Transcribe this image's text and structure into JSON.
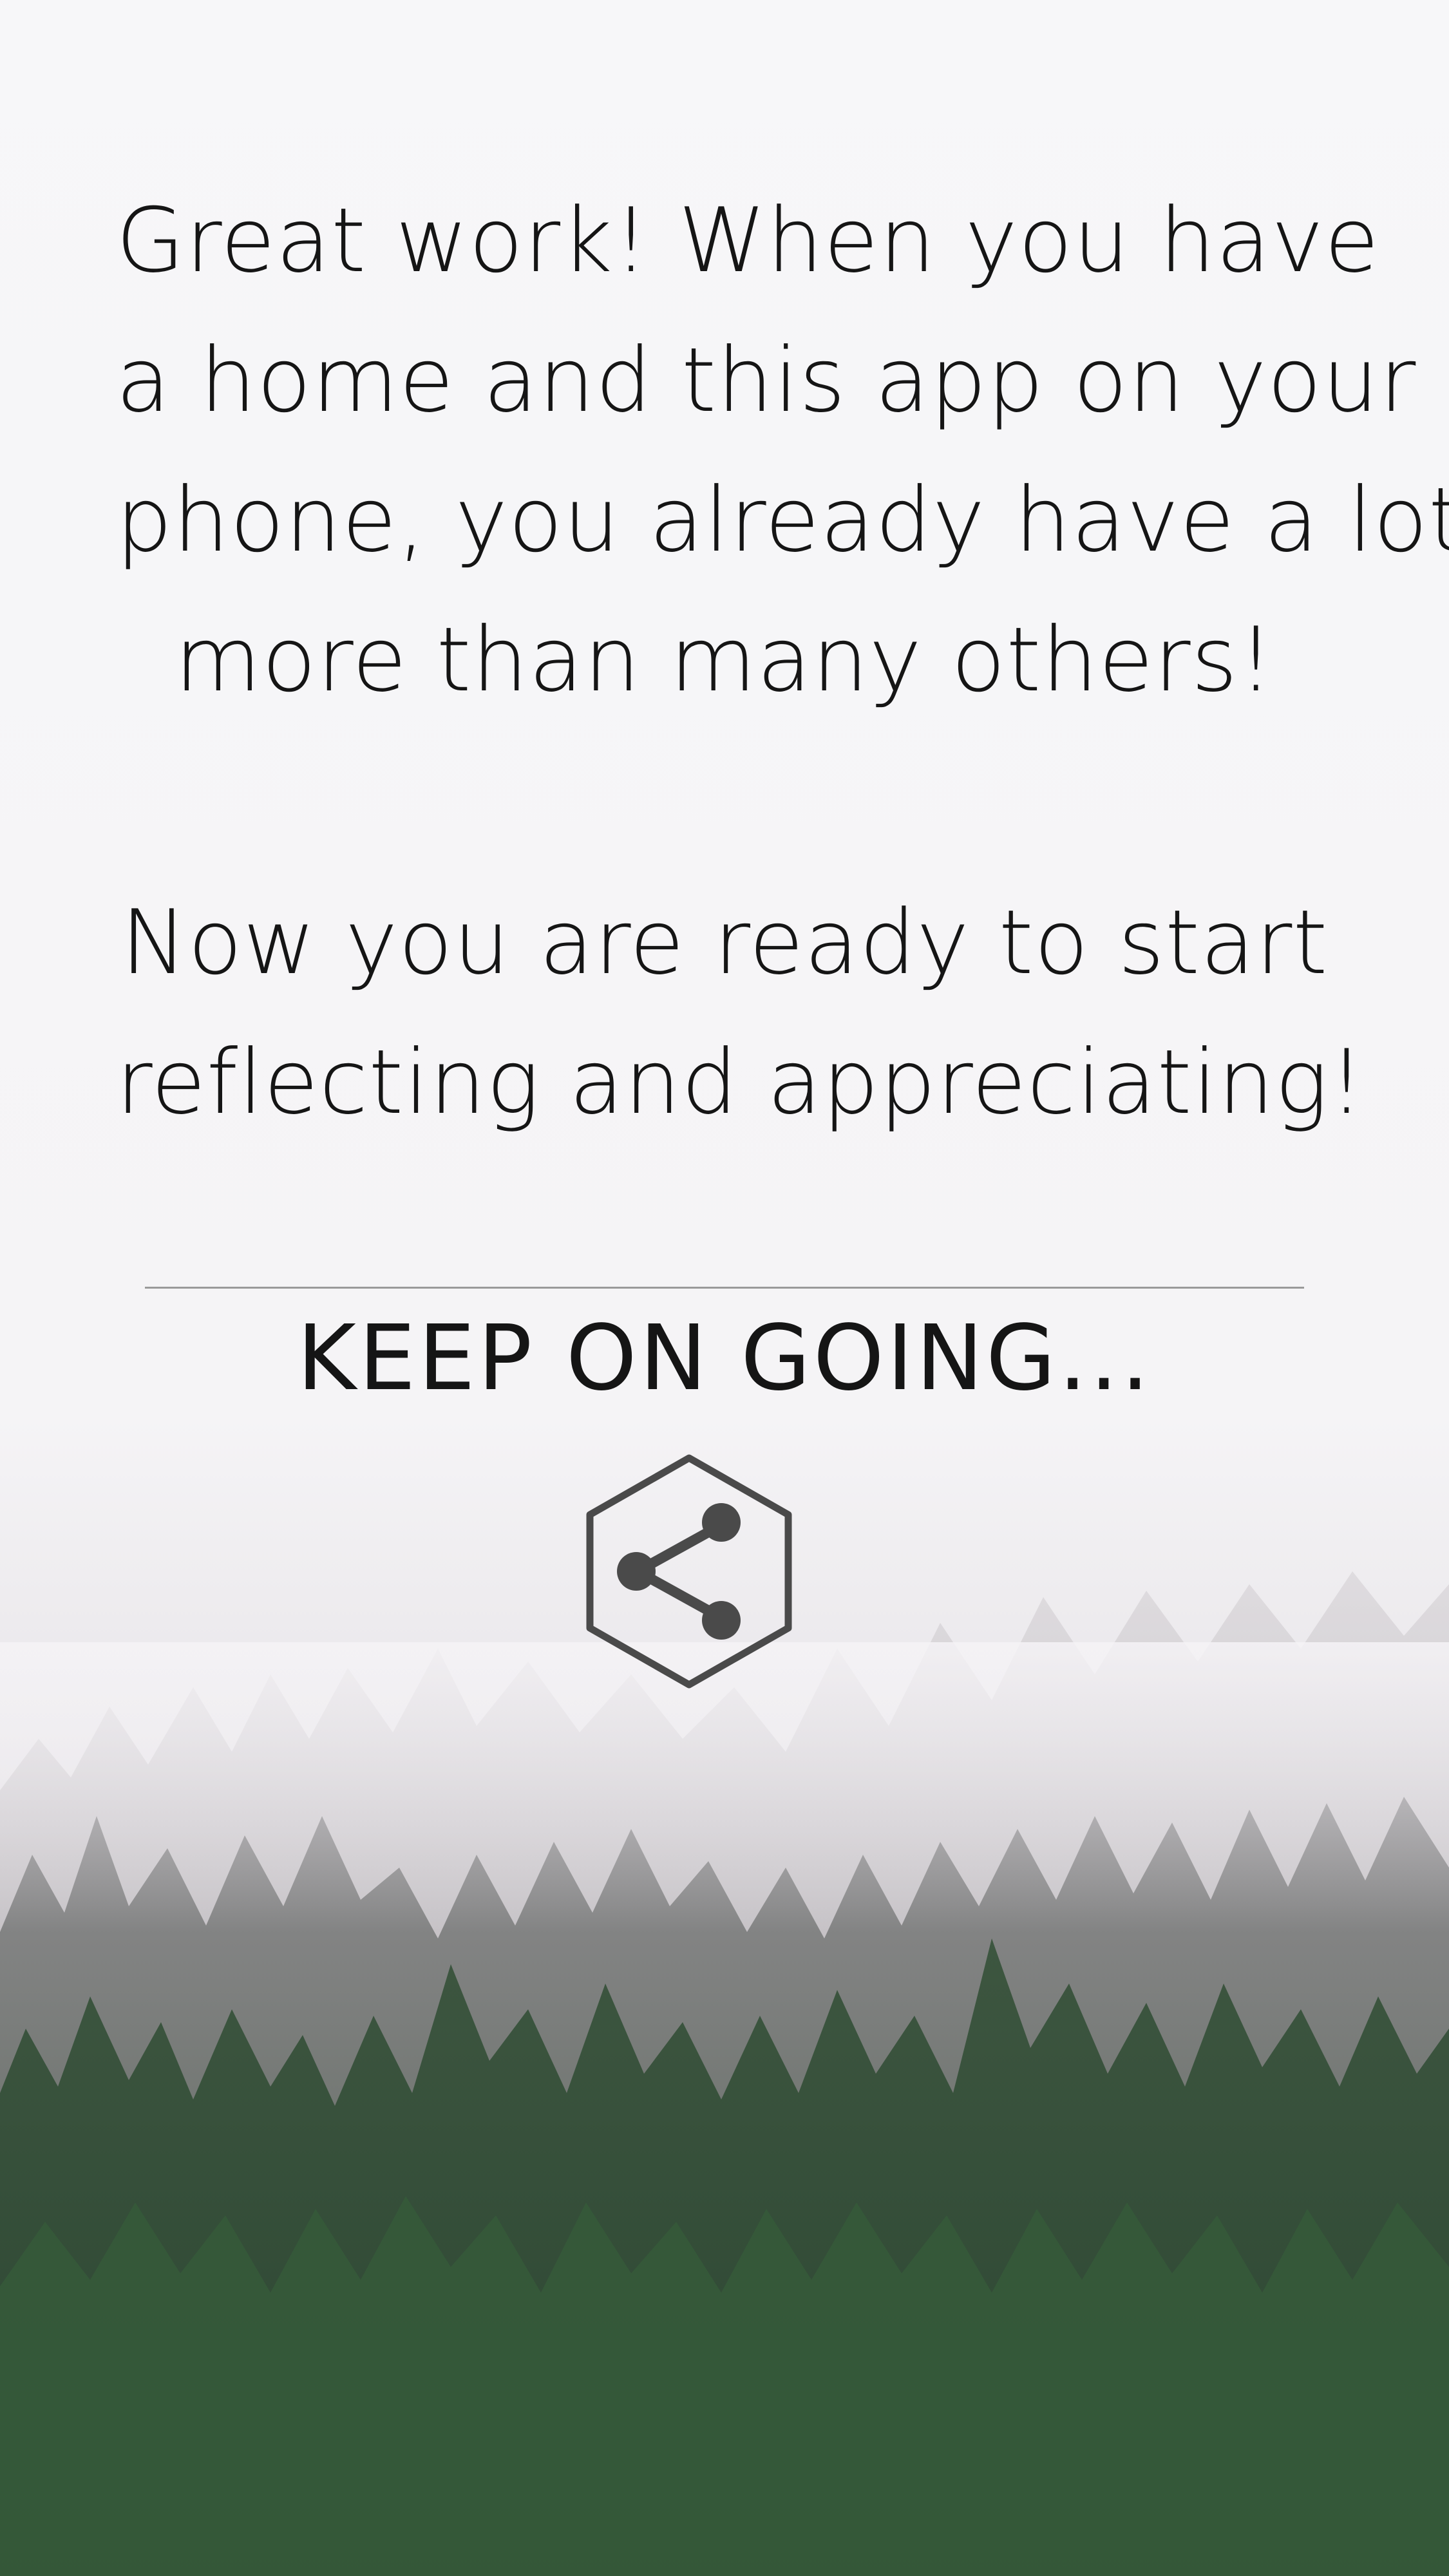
{
  "main": {
    "message_1_lines": [
      "Great work! When you have",
      "a home and this app on your",
      "phone, you already have a lot",
      "more than many others!"
    ],
    "message_2_lines": [
      "Now you are ready to start",
      "reflecting and appreciating!"
    ],
    "keep_going_label": "KEEP ON GOING..."
  },
  "share": {
    "icon": "share-icon"
  },
  "colors": {
    "background": "#f7f7f9",
    "text": "#151515",
    "icon": "#4a4a4a",
    "divider": "#9a9a9a",
    "forest_dark": "#2e4a33",
    "forest_mid": "#4f6e4e",
    "fog": "#e9e6ea"
  }
}
